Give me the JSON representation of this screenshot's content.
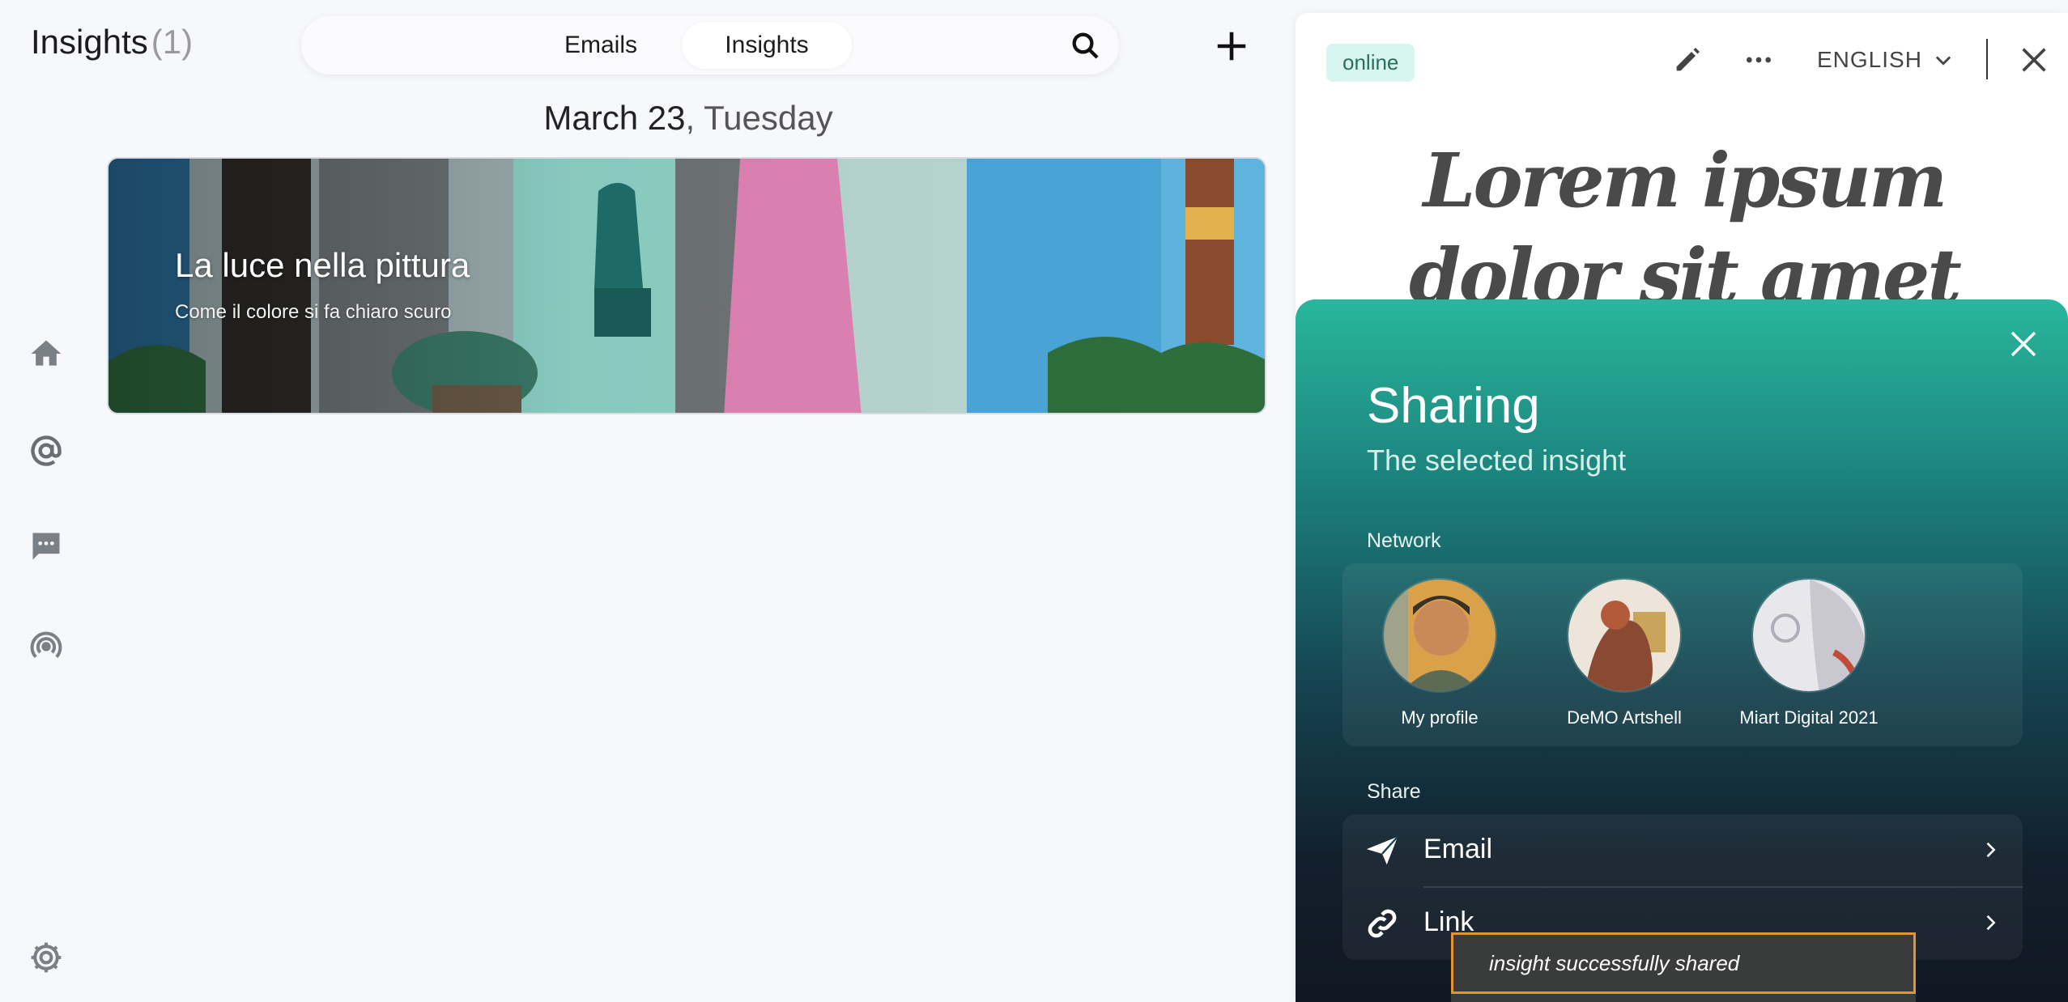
{
  "header": {
    "title": "Insights",
    "count": "(1)",
    "tabs": [
      {
        "label": "Emails",
        "active": false
      },
      {
        "label": "Insights",
        "active": true
      }
    ]
  },
  "feed": {
    "date": "March 23",
    "weekday": ", Tuesday",
    "card": {
      "title": "La luce nella pittura",
      "subtitle": "Come il colore si fa chiaro scuro"
    }
  },
  "sidebar": {
    "icons": [
      "home-icon",
      "at-icon",
      "chat-icon",
      "broadcast-icon",
      "settings-icon"
    ]
  },
  "document": {
    "status": "online",
    "language": "ENGLISH",
    "heading": "Lorem ipsum dolor sit amet"
  },
  "sharing": {
    "title": "Sharing",
    "subtitle": "The selected insight",
    "network_label": "Network",
    "profiles": [
      {
        "name": "My profile"
      },
      {
        "name": "DeMO Artshell"
      },
      {
        "name": "Miart Digital 2021"
      }
    ],
    "share_label": "Share",
    "options": [
      {
        "label": "Email",
        "icon": "paper-plane-icon"
      },
      {
        "label": "Link",
        "icon": "link-icon"
      }
    ]
  },
  "toast": {
    "message": "insight successfully shared"
  },
  "colors": {
    "accent_teal": "#28b79c",
    "toast_border": "#e8922d",
    "badge_bg": "#d8f6ef"
  }
}
